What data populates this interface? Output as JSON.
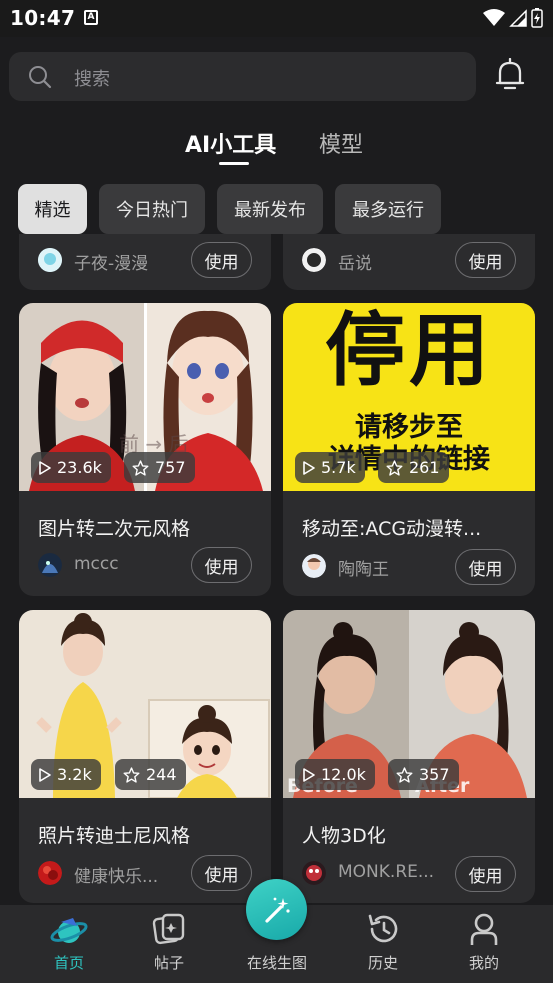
{
  "status_bar": {
    "time": "10:47",
    "notification_letter": "A"
  },
  "search": {
    "placeholder": "搜索"
  },
  "tabs": [
    {
      "label": "AI小工具",
      "active": true
    },
    {
      "label": "模型",
      "active": false
    }
  ],
  "filters": [
    {
      "label": "精选",
      "active": true
    },
    {
      "label": "今日热门",
      "active": false
    },
    {
      "label": "最新发布",
      "active": false
    },
    {
      "label": "最多运行",
      "active": false
    }
  ],
  "cards": [
    {
      "title": "",
      "author": "子夜-漫漫",
      "use_label": "使用"
    },
    {
      "title": "",
      "author": "岳说",
      "use_label": "使用"
    },
    {
      "title": "图片转二次元风格",
      "author": "mccc",
      "runs": "23.6k",
      "stars": "757",
      "image_overlay": "前 → 后",
      "use_label": "使用"
    },
    {
      "title": "移动至:ACG动漫转...",
      "author": "陶陶王",
      "runs": "5.7k",
      "stars": "261",
      "image_text_big": "停用",
      "image_text_small_1": "请移步至",
      "image_text_small_2": "详情中的链接",
      "use_label": "使用"
    },
    {
      "title": "照片转迪士尼风格",
      "author": "健康快乐...",
      "runs": "3.2k",
      "stars": "244",
      "use_label": "使用"
    },
    {
      "title": "人物3D化",
      "author": "MONK.RE...",
      "runs": "12.0k",
      "stars": "357",
      "image_label_left": "Before",
      "image_label_right": "After",
      "use_label": "使用"
    }
  ],
  "bottom_nav": [
    {
      "label": "首页",
      "active": true
    },
    {
      "label": "帖子",
      "active": false
    },
    {
      "label": "在线生图",
      "active": false
    },
    {
      "label": "历史",
      "active": false
    },
    {
      "label": "我的",
      "active": false
    }
  ],
  "colors": {
    "accent": "#2ec4c0",
    "background": "#1c1c1e",
    "card": "#2c2c2e",
    "banner_yellow": "#f7e316"
  }
}
